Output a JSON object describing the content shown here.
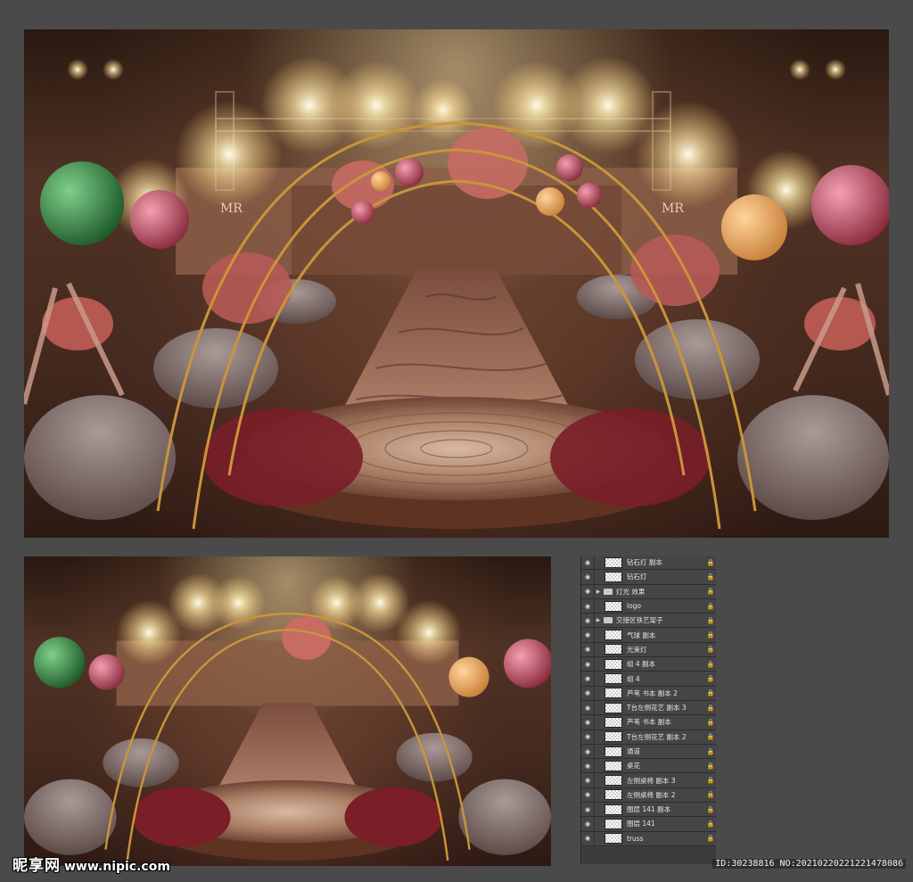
{
  "layers_panel": {
    "layers": [
      {
        "name": "钻石灯 副本",
        "type": "layer"
      },
      {
        "name": "钻石灯",
        "type": "layer"
      },
      {
        "name": "灯光 效果",
        "type": "folder"
      },
      {
        "name": "logo",
        "type": "layer"
      },
      {
        "name": "交接区铁艺架子",
        "type": "folder"
      },
      {
        "name": "气球 副本",
        "type": "layer"
      },
      {
        "name": "光束灯",
        "type": "layer"
      },
      {
        "name": "组 4 副本",
        "type": "layer"
      },
      {
        "name": "组 4",
        "type": "layer"
      },
      {
        "name": "芦苇 书本 副本 2",
        "type": "layer"
      },
      {
        "name": "T台左侧花艺 副本 3",
        "type": "layer"
      },
      {
        "name": "芦苇 书本 副本",
        "type": "layer"
      },
      {
        "name": "T台左侧花艺 副本 2",
        "type": "layer"
      },
      {
        "name": "通道",
        "type": "layer"
      },
      {
        "name": "桌花",
        "type": "layer"
      },
      {
        "name": "左侧桌椅 副本 3",
        "type": "layer"
      },
      {
        "name": "左侧桌椅 副本 2",
        "type": "layer"
      },
      {
        "name": "图层 141 副本",
        "type": "layer"
      },
      {
        "name": "图层 141",
        "type": "layer"
      },
      {
        "name": "truss",
        "type": "layer"
      }
    ]
  },
  "scene": {
    "logo_left": "MR",
    "logo_right": "MR"
  },
  "watermark": {
    "brand": "昵享网",
    "url": "www.nipic.com",
    "id_text": "ID:30238816 NO:20210220221221478086"
  },
  "colors": {
    "panel_bg": "#3c3c3c",
    "row_bg": "#454545",
    "gold_arch": "#c9953a",
    "balloon_green": "#3e8c4c",
    "balloon_pink": "#c7586c",
    "balloon_orange": "#e2a45a"
  }
}
